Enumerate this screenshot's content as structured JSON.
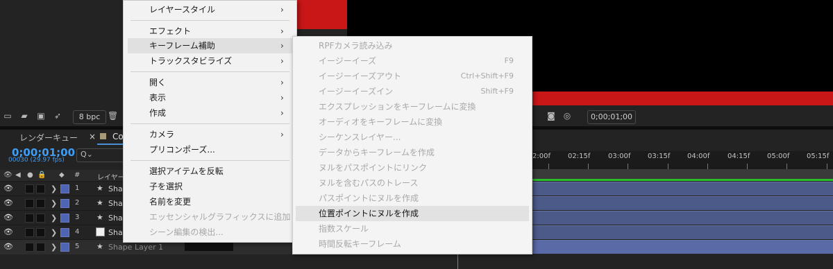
{
  "viewer": {
    "bpc": "8 bpc",
    "timecode": "0;00;01;00"
  },
  "panel": {
    "render_queue_tab": "レンダーキュー",
    "close_glyph": "×",
    "comp_tab": "Co",
    "timecode": "0;00;01;00",
    "frame_info": "00030 (29.97 fps)",
    "search_glyph": "Q⌄",
    "col_num": "#",
    "col_layer": "レイヤー"
  },
  "layers": [
    {
      "num": "1",
      "name": "Shap"
    },
    {
      "num": "2",
      "name": "Shap"
    },
    {
      "num": "3",
      "name": "Shap"
    },
    {
      "num": "4",
      "name": "Sha"
    },
    {
      "num": "5",
      "name": "Shape Layer 1"
    }
  ],
  "ruler": [
    "2:00f",
    "02:15f",
    "03:00f",
    "03:15f",
    "04:00f",
    "04:15f",
    "05:00f",
    "05:15f"
  ],
  "menu": [
    {
      "label": "レイヤースタイル",
      "sub": true
    },
    {
      "label": "エフェクト",
      "sub": true
    },
    {
      "label": "キーフレーム補助",
      "sub": true,
      "highlight": true
    },
    {
      "label": "トラックスタビライズ",
      "sub": true
    },
    {
      "label": "開く",
      "sub": true
    },
    {
      "label": "表示",
      "sub": true
    },
    {
      "label": "作成",
      "sub": true
    },
    {
      "label": "カメラ",
      "sub": true
    },
    {
      "label": "プリコンポーズ...",
      "sub": false
    },
    {
      "label": "選択アイテムを反転",
      "sub": false
    },
    {
      "label": "子を選択",
      "sub": false
    },
    {
      "label": "名前を変更",
      "sub": false
    },
    {
      "label": "エッセンシャルグラフィックスに追加",
      "sub": false,
      "disabled": true
    },
    {
      "label": "シーン編集の検出...",
      "sub": false,
      "disabled": true
    }
  ],
  "submenu": [
    {
      "label": "RPFカメラ読み込み",
      "shortcut": ""
    },
    {
      "label": "イージーイーズ",
      "shortcut": "F9"
    },
    {
      "label": "イージーイーズアウト",
      "shortcut": "Ctrl+Shift+F9"
    },
    {
      "label": "イージーイーズイン",
      "shortcut": "Shift+F9"
    },
    {
      "label": "エクスプレッションをキーフレームに変換",
      "shortcut": ""
    },
    {
      "label": "オーディオをキーフレームに変換",
      "shortcut": ""
    },
    {
      "label": "シーケンスレイヤー...",
      "shortcut": ""
    },
    {
      "label": "データからキーフレームを作成",
      "shortcut": ""
    },
    {
      "label": "ヌルをパスポイントにリンク",
      "shortcut": ""
    },
    {
      "label": "ヌルを含むパスのトレース",
      "shortcut": ""
    },
    {
      "label": "パスポイントにヌルを作成",
      "shortcut": ""
    },
    {
      "label": "位置ポイントにヌルを作成",
      "shortcut": "",
      "highlight": true
    },
    {
      "label": "指数スケール",
      "shortcut": ""
    },
    {
      "label": "時間反転キーフレーム",
      "shortcut": ""
    }
  ],
  "colors": {
    "accent_blue": "#3e9ef5",
    "comp_red": "#c91616",
    "layer_bar": "#4c5a8a",
    "label_purple": "#5064b4",
    "menu_bg": "#f2f2f2"
  }
}
